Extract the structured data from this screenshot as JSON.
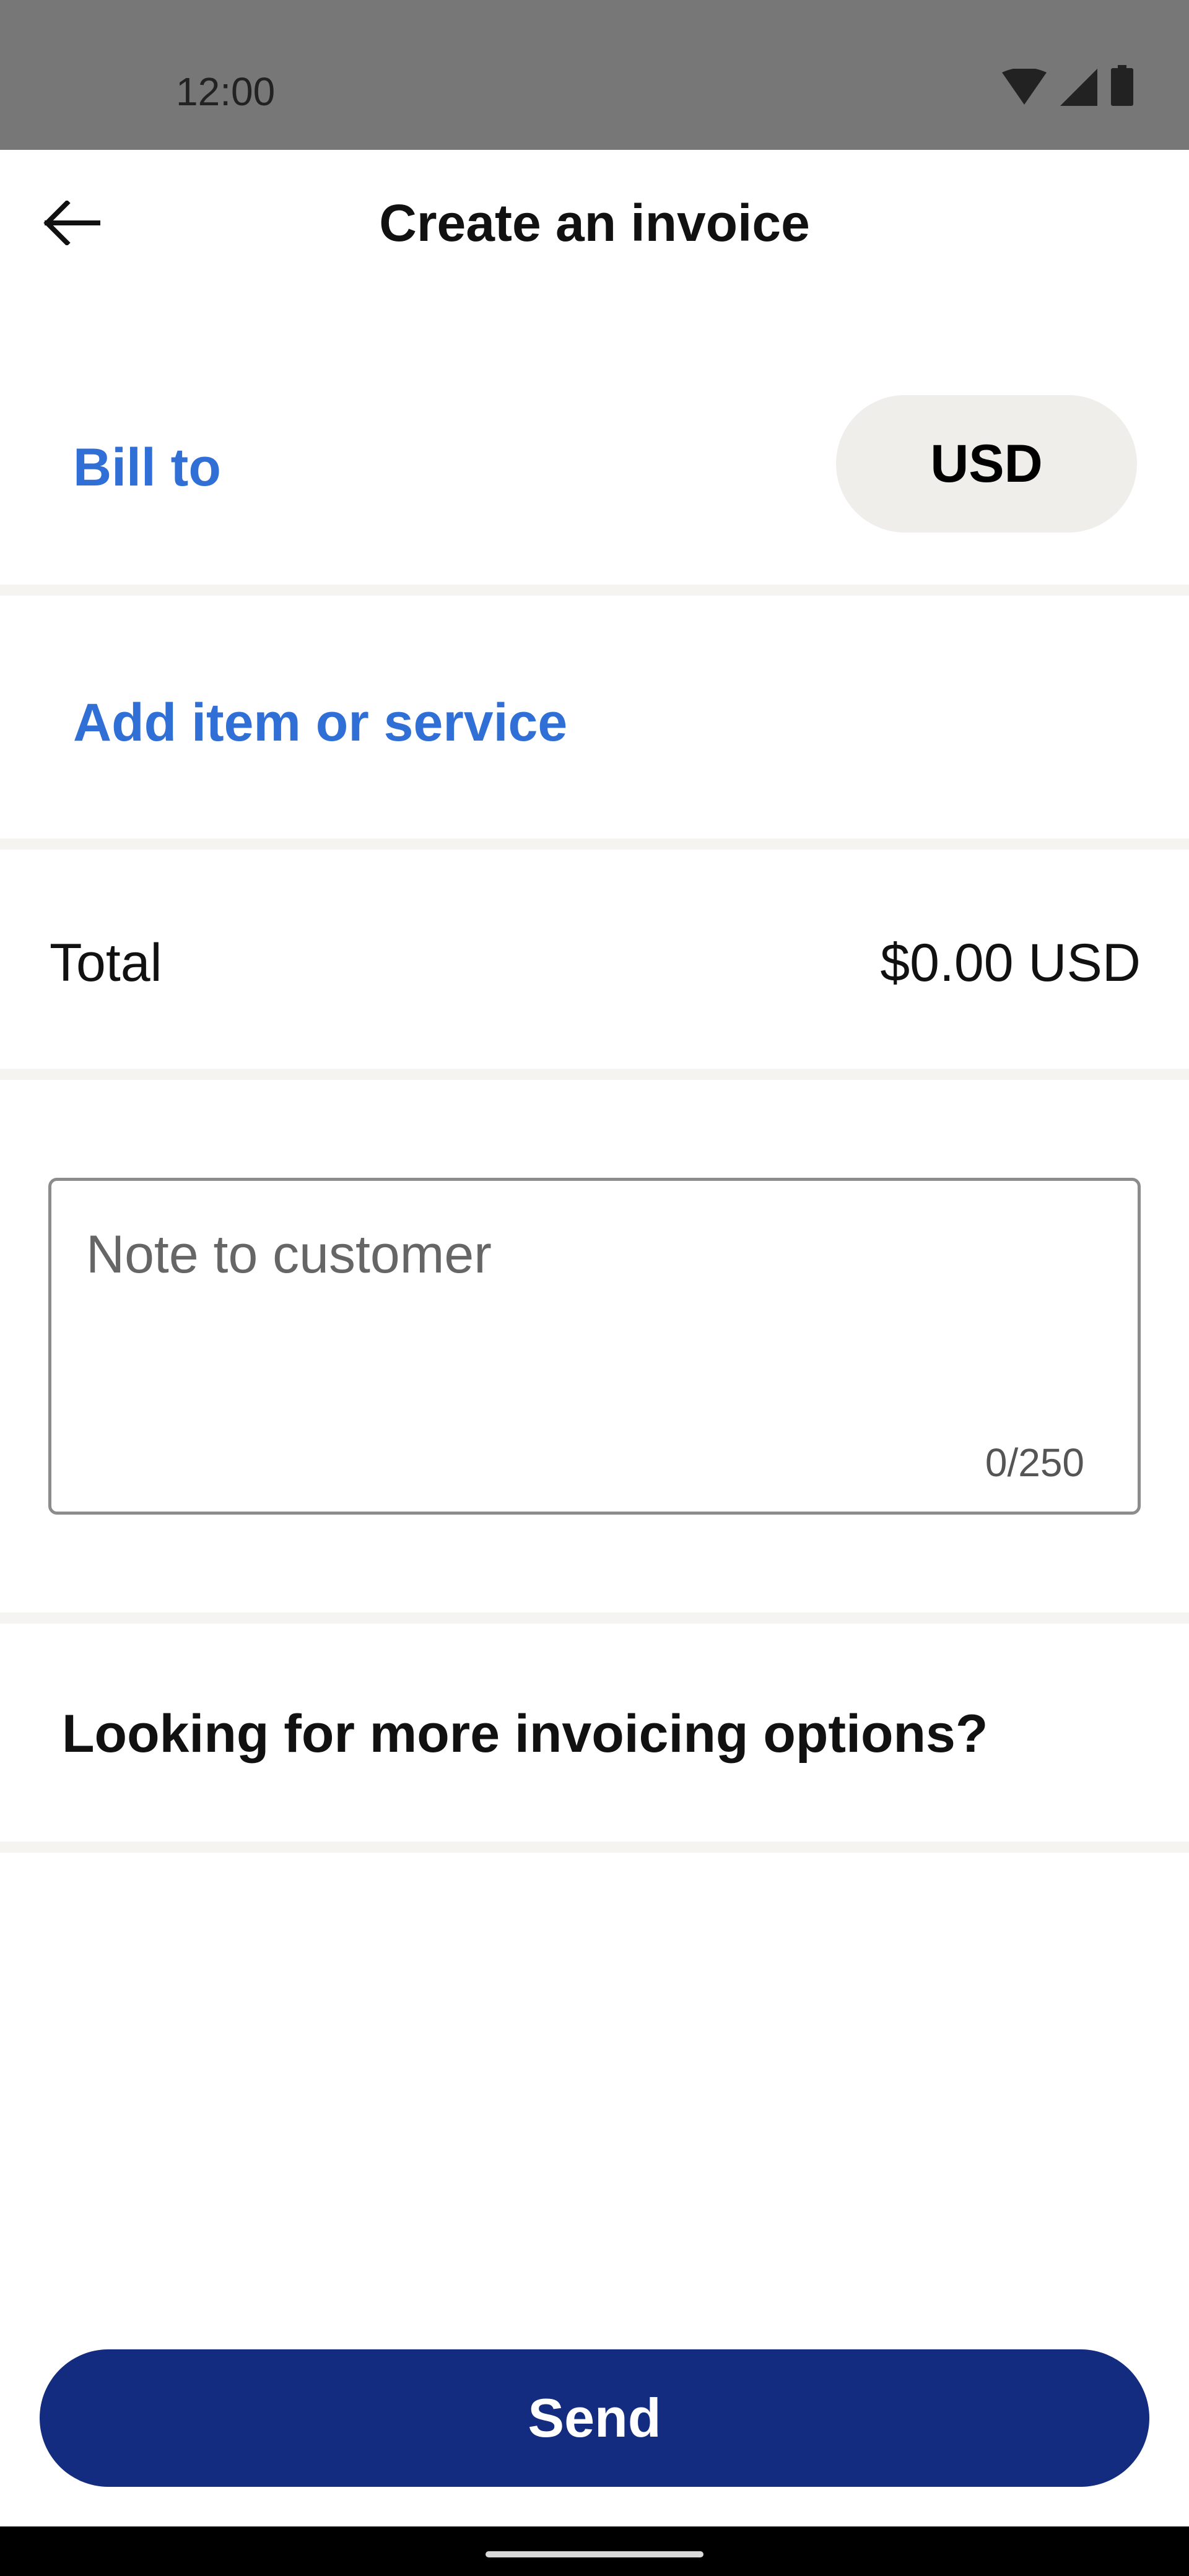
{
  "status_bar": {
    "time": "12:00",
    "icons": [
      "wifi-icon",
      "signal-icon",
      "battery-icon"
    ]
  },
  "header": {
    "title": "Create an invoice",
    "back_icon": "arrow-left-icon"
  },
  "bill_to": {
    "label": "Bill to",
    "currency": "USD"
  },
  "items": {
    "add_label": "Add item or service"
  },
  "total": {
    "label": "Total",
    "value": "$0.00 USD"
  },
  "note": {
    "placeholder": "Note to customer",
    "value": "",
    "counter": "0/250"
  },
  "more_options": {
    "label": "Looking for more invoicing options?"
  },
  "footer": {
    "send_label": "Send"
  },
  "colors": {
    "link_blue": "#2f6fd6",
    "send_button": "#142c80",
    "pill_background": "#efeeeb",
    "status_bar": "#777777",
    "divider": "#f5f4f1"
  }
}
